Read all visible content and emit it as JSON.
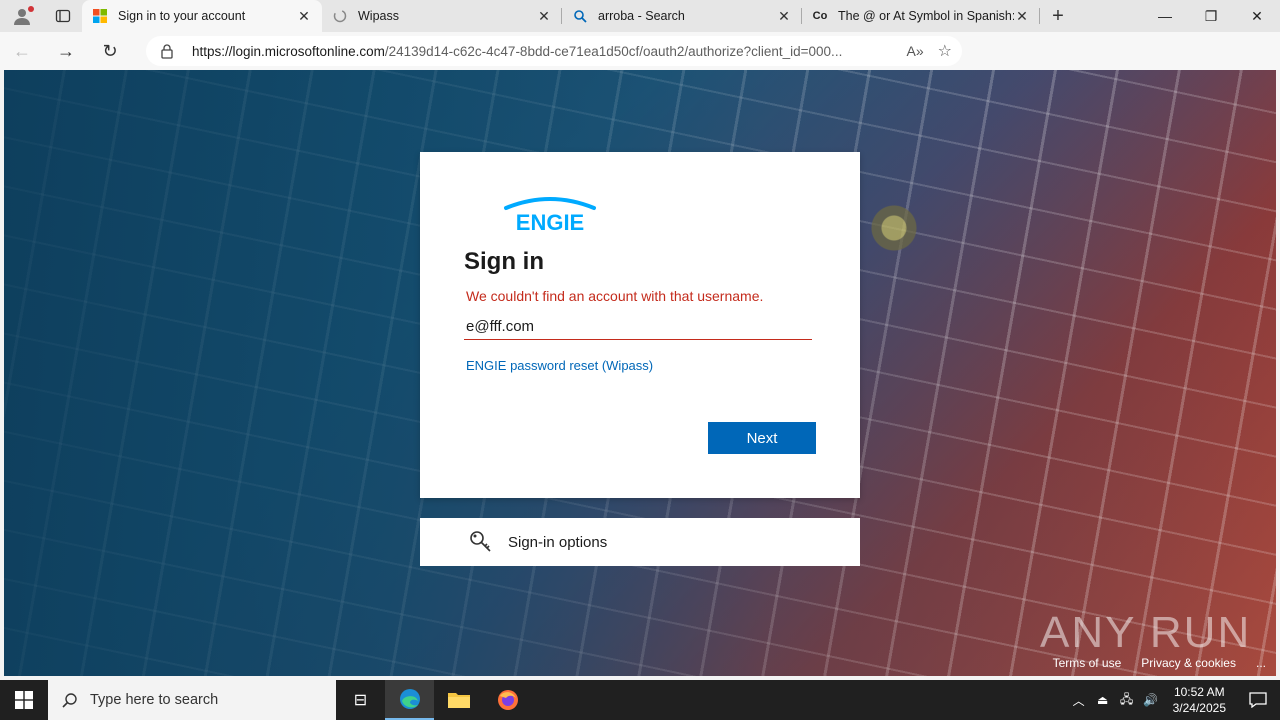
{
  "browser": {
    "tabs": [
      {
        "title": "Sign in to your account",
        "active": true
      },
      {
        "title": "Wipass",
        "active": false
      },
      {
        "title": "arroba - Search",
        "active": false
      },
      {
        "title": "The @ or At Symbol in Spanish: H",
        "active": false
      }
    ],
    "url_host": "https://login.microsoftonline.com",
    "url_path": "/24139d14-c62c-4c47-8bdd-ce71ea1d50cf/oauth2/authorize?client_id=000..."
  },
  "signin": {
    "logo_text": "ENGIE",
    "title": "Sign in",
    "error": "We couldn't find an account with that username.",
    "username_value": "e@fff.com",
    "reset_link": "ENGIE password reset (Wipass)",
    "next_label": "Next",
    "options_label": "Sign-in options"
  },
  "footer": {
    "terms": "Terms of use",
    "privacy": "Privacy & cookies",
    "more": "..."
  },
  "watermark": "ANY RUN",
  "taskbar": {
    "search_placeholder": "Type here to search",
    "time": "10:52 AM",
    "date": "3/24/2025"
  },
  "colors": {
    "accent": "#0067b8",
    "error": "#c42b1c",
    "engie_blue": "#00aaff"
  }
}
